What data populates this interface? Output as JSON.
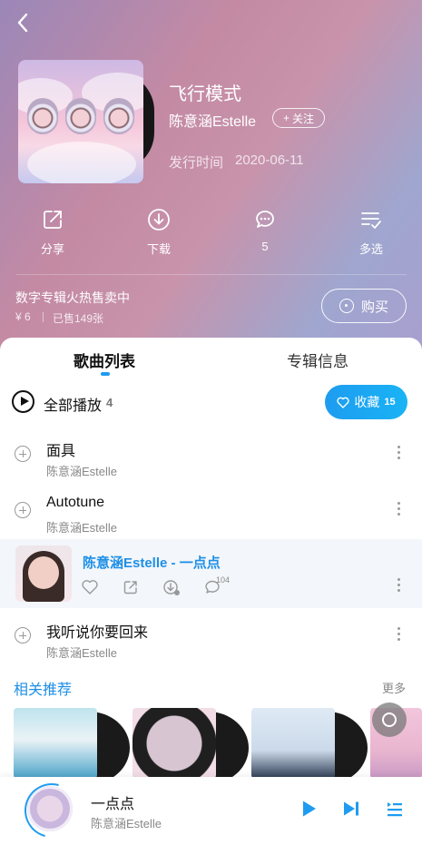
{
  "album": {
    "title": "飞行模式",
    "artist": "陈意涵Estelle",
    "follow_label": "关注",
    "release_label": "发行时间",
    "release_date": "2020-06-11"
  },
  "actions": [
    {
      "label": "分享",
      "icon": "share-icon"
    },
    {
      "label": "下载",
      "icon": "download-icon"
    },
    {
      "label": "5",
      "icon": "comment-icon"
    },
    {
      "label": "多选",
      "icon": "multi-select-icon"
    }
  ],
  "promo": {
    "title": "数字专辑火热售卖中",
    "price": "¥ 6",
    "sold": "已售149张",
    "buy_label": "购买"
  },
  "tabs": {
    "songs": "歌曲列表",
    "info": "专辑信息"
  },
  "play_all": {
    "label": "全部播放",
    "count": "4"
  },
  "collect": {
    "label": "收藏",
    "count": "15"
  },
  "songs": [
    {
      "title": "面具",
      "artist": "陈意涵Estelle"
    },
    {
      "title": "Autotune",
      "artist": "陈意涵Estelle"
    },
    {
      "title": "陈意涵Estelle - 一点点",
      "comment_count": "104"
    },
    {
      "title": "我听说你要回来",
      "artist": "陈意涵Estelle"
    }
  ],
  "recommend": {
    "title": "相关推荐",
    "more": "更多"
  },
  "player": {
    "title": "一点点",
    "artist": "陈意涵Estelle"
  },
  "colors": {
    "accent": "#1e9cf0",
    "playing_text": "#1e8fe6"
  }
}
